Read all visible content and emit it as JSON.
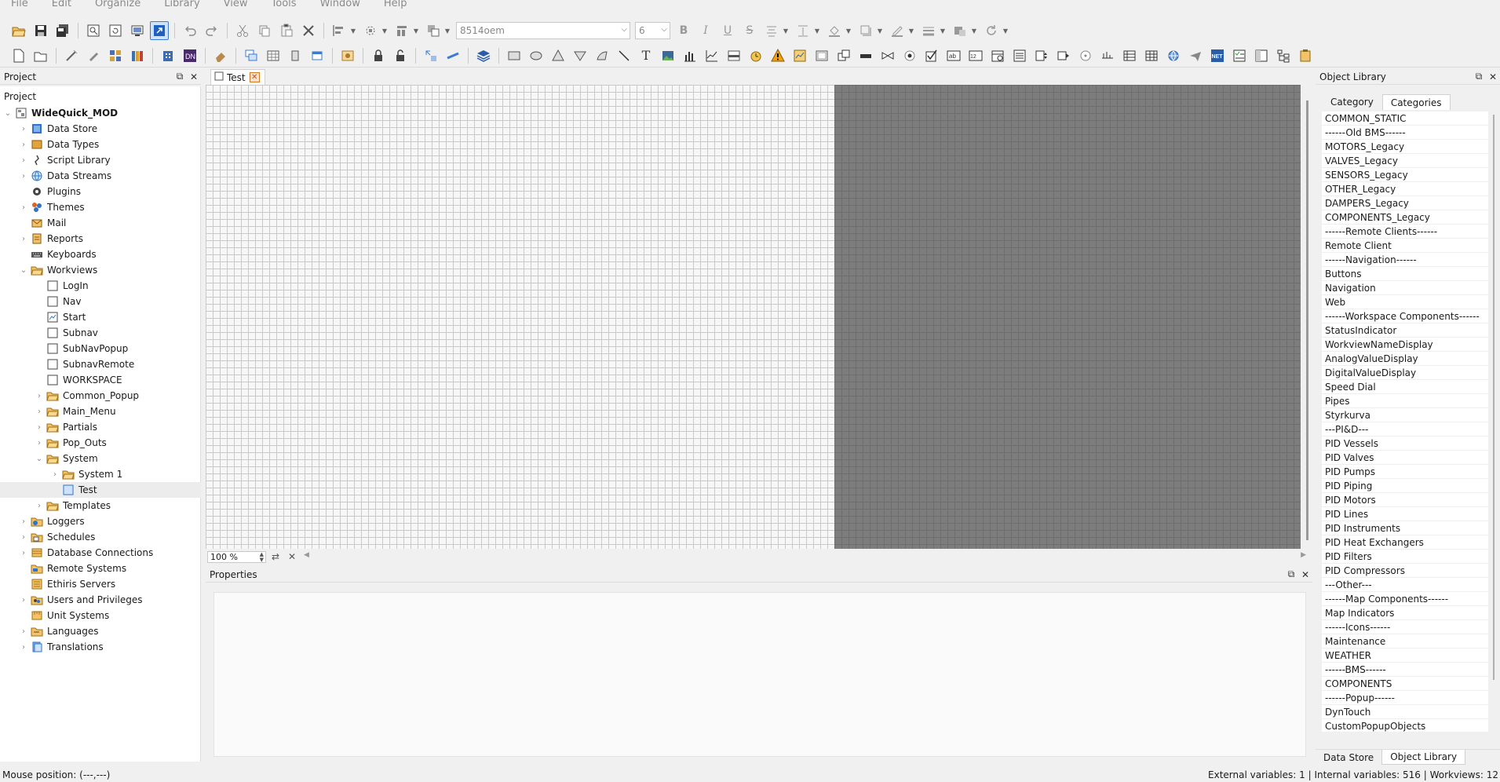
{
  "menu": [
    "File",
    "Edit",
    "Organize",
    "Library",
    "View",
    "Tools",
    "Window",
    "Help"
  ],
  "toolbar": {
    "font_name": "8514oem",
    "font_size": "6"
  },
  "project_panel": {
    "title": "Project",
    "root_label": "Project",
    "items": [
      {
        "label": "WideQuick_MOD",
        "level": 0,
        "chev": "⌄",
        "icon": "project-icon",
        "bold": true
      },
      {
        "label": "Data Store",
        "level": 1,
        "chev": "›",
        "icon": "data-store-icon"
      },
      {
        "label": "Data Types",
        "level": 1,
        "chev": "›",
        "icon": "data-types-icon"
      },
      {
        "label": "Script Library",
        "level": 1,
        "chev": "›",
        "icon": "script-icon"
      },
      {
        "label": "Data Streams",
        "level": 1,
        "chev": "›",
        "icon": "globe-icon"
      },
      {
        "label": "Plugins",
        "level": 1,
        "chev": "",
        "icon": "plugin-icon"
      },
      {
        "label": "Themes",
        "level": 1,
        "chev": "›",
        "icon": "themes-icon"
      },
      {
        "label": "Mail",
        "level": 1,
        "chev": "",
        "icon": "mail-icon"
      },
      {
        "label": "Reports",
        "level": 1,
        "chev": "›",
        "icon": "report-icon"
      },
      {
        "label": "Keyboards",
        "level": 1,
        "chev": "",
        "icon": "keyboard-icon"
      },
      {
        "label": "Workviews",
        "level": 1,
        "chev": "⌄",
        "icon": "folder-icon"
      },
      {
        "label": "LogIn",
        "level": 2,
        "chev": "",
        "icon": "view-icon"
      },
      {
        "label": "Nav",
        "level": 2,
        "chev": "",
        "icon": "view-icon"
      },
      {
        "label": "Start",
        "level": 2,
        "chev": "",
        "icon": "start-view-icon"
      },
      {
        "label": "Subnav",
        "level": 2,
        "chev": "",
        "icon": "view-icon"
      },
      {
        "label": "SubNavPopup",
        "level": 2,
        "chev": "",
        "icon": "view-icon"
      },
      {
        "label": "SubnavRemote",
        "level": 2,
        "chev": "",
        "icon": "view-icon"
      },
      {
        "label": "WORKSPACE",
        "level": 2,
        "chev": "",
        "icon": "view-icon"
      },
      {
        "label": "Common_Popup",
        "level": 2,
        "chev": "›",
        "icon": "folder-icon"
      },
      {
        "label": "Main_Menu",
        "level": 2,
        "chev": "›",
        "icon": "folder-icon"
      },
      {
        "label": "Partials",
        "level": 2,
        "chev": "›",
        "icon": "folder-icon"
      },
      {
        "label": "Pop_Outs",
        "level": 2,
        "chev": "›",
        "icon": "folder-icon"
      },
      {
        "label": "System",
        "level": 2,
        "chev": "⌄",
        "icon": "folder-icon"
      },
      {
        "label": "System 1",
        "level": 3,
        "chev": "›",
        "icon": "folder-icon"
      },
      {
        "label": "Test",
        "level": 3,
        "chev": "",
        "icon": "view-selected-icon",
        "selected": true
      },
      {
        "label": "Templates",
        "level": 2,
        "chev": "›",
        "icon": "folder-icon"
      },
      {
        "label": "Loggers",
        "level": 1,
        "chev": "›",
        "icon": "loggers-icon"
      },
      {
        "label": "Schedules",
        "level": 1,
        "chev": "›",
        "icon": "schedules-icon"
      },
      {
        "label": "Database Connections",
        "level": 1,
        "chev": "›",
        "icon": "database-icon"
      },
      {
        "label": "Remote Systems",
        "level": 1,
        "chev": "",
        "icon": "remote-icon"
      },
      {
        "label": "Ethiris Servers",
        "level": 1,
        "chev": "",
        "icon": "server-icon"
      },
      {
        "label": "Users and Privileges",
        "level": 1,
        "chev": "›",
        "icon": "users-icon"
      },
      {
        "label": "Unit Systems",
        "level": 1,
        "chev": "",
        "icon": "units-icon"
      },
      {
        "label": "Languages",
        "level": 1,
        "chev": "›",
        "icon": "languages-icon"
      },
      {
        "label": "Translations",
        "level": 1,
        "chev": "›",
        "icon": "translations-icon"
      }
    ]
  },
  "document": {
    "tab_label": "Test",
    "zoom": "100 %"
  },
  "properties": {
    "title": "Properties"
  },
  "object_library": {
    "title": "Object Library",
    "tabs": [
      "Category",
      "Categories"
    ],
    "items": [
      "COMMON_STATIC",
      "------Old BMS------",
      "MOTORS_Legacy",
      "VALVES_Legacy",
      "SENSORS_Legacy",
      "OTHER_Legacy",
      "DAMPERS_Legacy",
      "COMPONENTS_Legacy",
      "------Remote Clients------",
      "Remote Client",
      "------Navigation------",
      "Buttons",
      "Navigation",
      "Web",
      "------Workspace Components------",
      "StatusIndicator",
      "WorkviewNameDisplay",
      "AnalogValueDisplay",
      "DigitalValueDisplay",
      "Speed Dial",
      "Pipes",
      "Styrkurva",
      "---PI&D---",
      "PID Vessels",
      "PID Valves",
      "PID Pumps",
      "PID Piping",
      "PID Motors",
      "PID Lines",
      "PID Instruments",
      "PID Heat Exchangers",
      "PID Filters",
      "PID Compressors",
      "---Other---",
      "------Map Components------",
      "Map Indicators",
      "------Icons------",
      "Maintenance",
      "WEATHER",
      "------BMS------",
      "COMPONENTS",
      "------Popup------",
      "DynTouch",
      "CustomPopupObjects"
    ],
    "bottom_tabs": [
      "Data Store",
      "Object Library"
    ]
  },
  "status": {
    "mouse_position": "Mouse position: (---,---)",
    "variables": "External variables: 1 | Internal variables: 516 | Workviews: 12"
  }
}
